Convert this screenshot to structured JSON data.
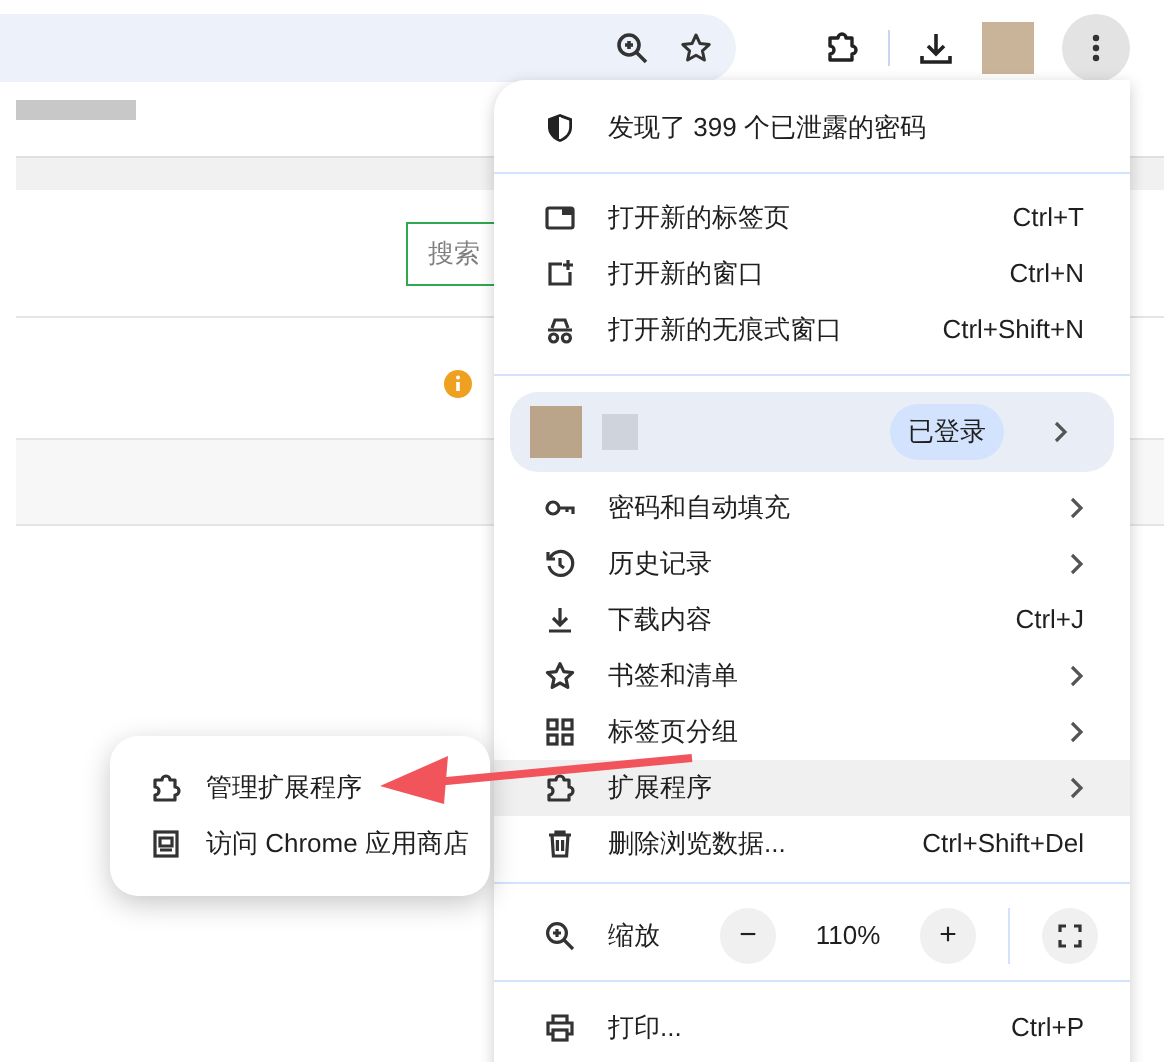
{
  "page": {
    "search": {
      "placeholder": "搜索"
    }
  },
  "menu": {
    "breach_notice": "发现了 399 个已泄露的密码",
    "groups": [
      [
        {
          "kind": "item",
          "label": "打开新的标签页",
          "shortcut": "Ctrl+T",
          "selected": false
        },
        {
          "kind": "item",
          "label": "打开新的窗口",
          "shortcut": "Ctrl+N",
          "selected": false
        },
        {
          "kind": "item",
          "label": "打开新的无痕式窗口",
          "shortcut": "Ctrl+Shift+N",
          "selected": false
        }
      ],
      [
        {
          "kind": "profile",
          "badge": "已登录",
          "submenu": true,
          "selected": false
        },
        {
          "kind": "item",
          "label": "密码和自动填充",
          "submenu": true,
          "selected": false
        },
        {
          "kind": "item",
          "label": "历史记录",
          "submenu": true,
          "selected": false
        },
        {
          "kind": "item",
          "label": "下载内容",
          "shortcut": "Ctrl+J",
          "selected": false
        },
        {
          "kind": "item",
          "label": "书签和清单",
          "submenu": true,
          "selected": false
        },
        {
          "kind": "item",
          "label": "标签页分组",
          "submenu": true,
          "selected": false
        },
        {
          "kind": "item",
          "label": "扩展程序",
          "submenu": true,
          "selected": true
        },
        {
          "kind": "item",
          "label": "删除浏览数据...",
          "shortcut": "Ctrl+Shift+Del",
          "selected": false
        }
      ],
      [
        {
          "kind": "zoom",
          "label": "缩放",
          "minus": "−",
          "value": "110%",
          "plus": "+"
        }
      ],
      [
        {
          "kind": "item",
          "label": "打印...",
          "shortcut": "Ctrl+P",
          "selected": false
        }
      ]
    ]
  },
  "submenu": {
    "items": [
      {
        "label": "管理扩展程序"
      },
      {
        "label": "访问 Chrome 应用商店"
      }
    ]
  }
}
